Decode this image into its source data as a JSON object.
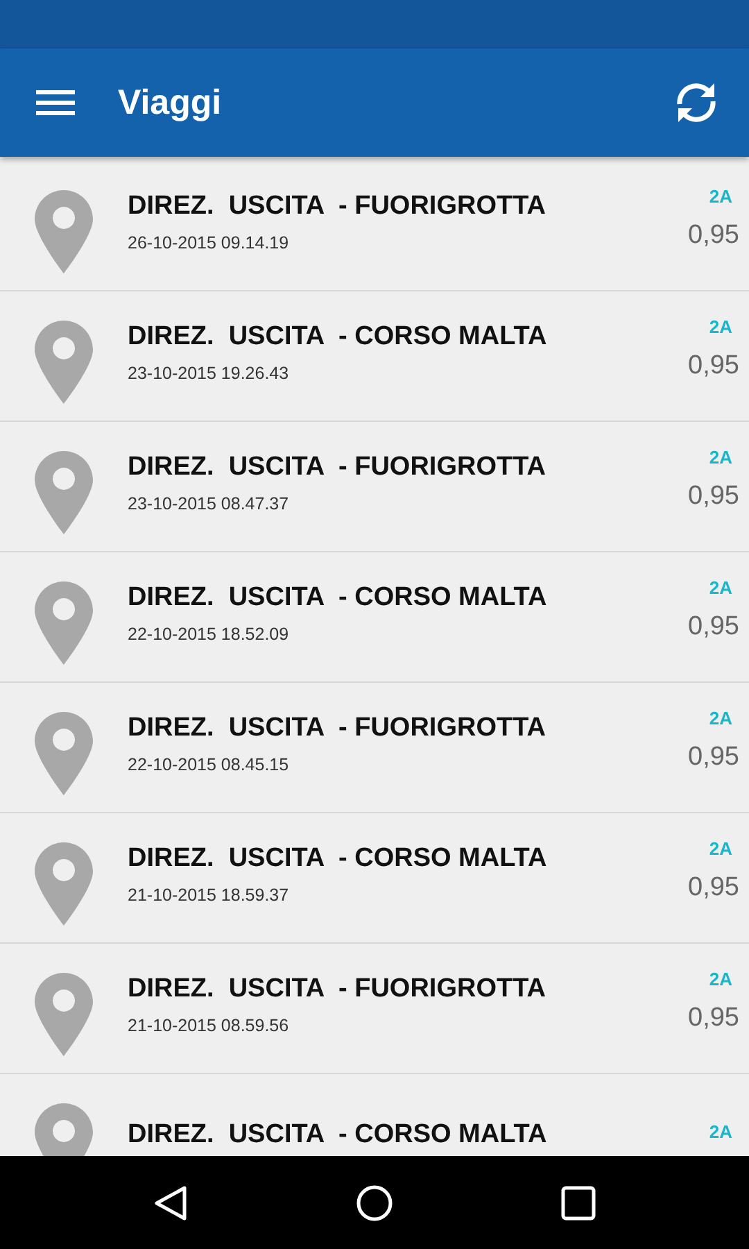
{
  "toolbar": {
    "title": "Viaggi"
  },
  "trips": [
    {
      "title": "DIREZ.  USCITA  - FUORIGROTTA",
      "datetime": "26-10-2015 09.14.19",
      "class": "2A",
      "price": "0,95"
    },
    {
      "title": "DIREZ.  USCITA  - CORSO MALTA",
      "datetime": "23-10-2015 19.26.43",
      "class": "2A",
      "price": "0,95"
    },
    {
      "title": "DIREZ.  USCITA  - FUORIGROTTA",
      "datetime": "23-10-2015 08.47.37",
      "class": "2A",
      "price": "0,95"
    },
    {
      "title": "DIREZ.  USCITA  - CORSO MALTA",
      "datetime": "22-10-2015 18.52.09",
      "class": "2A",
      "price": "0,95"
    },
    {
      "title": "DIREZ.  USCITA  - FUORIGROTTA",
      "datetime": "22-10-2015 08.45.15",
      "class": "2A",
      "price": "0,95"
    },
    {
      "title": "DIREZ.  USCITA  - CORSO MALTA",
      "datetime": "21-10-2015 18.59.37",
      "class": "2A",
      "price": "0,95"
    },
    {
      "title": "DIREZ.  USCITA  - FUORIGROTTA",
      "datetime": "21-10-2015 08.59.56",
      "class": "2A",
      "price": "0,95"
    },
    {
      "title": "DIREZ.  USCITA  - CORSO MALTA",
      "class": "2A"
    }
  ]
}
